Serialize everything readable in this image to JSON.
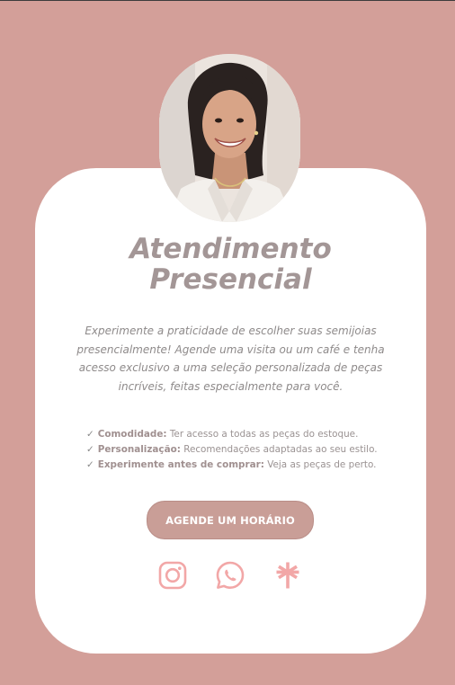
{
  "title": {
    "line1": "Atendimento",
    "line2": "Presencial"
  },
  "description": {
    "lines": [
      "Experimente a praticidade de escolher suas semijoias",
      "presencialmente! Agende uma visita ou um café e tenha",
      "acesso exclusivo a uma seleção personalizada de peças",
      "incríveis, feitas especialmente para você."
    ]
  },
  "features": [
    {
      "label": "Comodidade:",
      "text": " Ter acesso a todas as peças do estoque."
    },
    {
      "label": "Personalização:",
      "text": " Recomendações adaptadas ao seu estilo."
    },
    {
      "label": "Experimente antes de comprar:",
      "text": " Veja as peças de perto."
    }
  ],
  "cta": {
    "label": "AGENDE UM HORÁRIO"
  },
  "social": {
    "icons": [
      "instagram-icon",
      "whatsapp-icon",
      "linktree-icon"
    ]
  },
  "colors": {
    "background": "#d39f99",
    "card": "#ffffff",
    "title": "#a39696",
    "button": "#c99e97",
    "icon": "#f2a7a7"
  }
}
